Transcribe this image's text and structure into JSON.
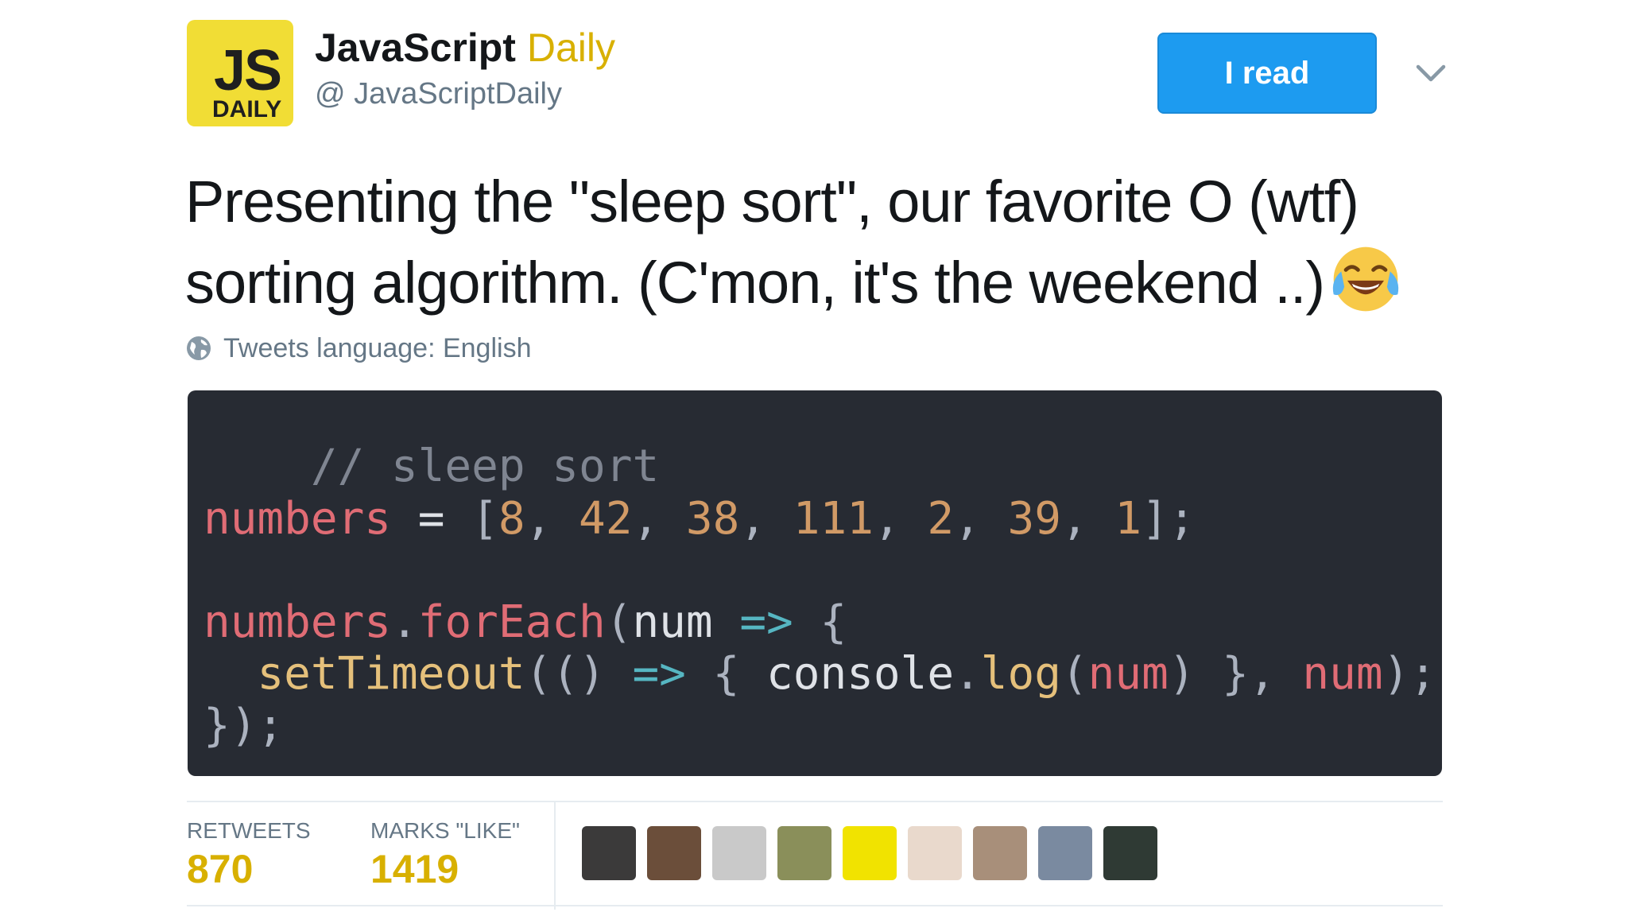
{
  "account": {
    "avatar_js": "JS",
    "avatar_daily": "DAILY",
    "name_part1": "JavaScript",
    "name_part2": "Daily",
    "handle": "@ JavaScriptDaily"
  },
  "follow_button": {
    "label": "I read"
  },
  "tweet": {
    "text": "Presenting the \"sleep sort\", our favorite O (wtf) sorting algorithm. (C'mon, it's the weekend ..)",
    "emoji_icon": "face-with-tears-of-joy-icon",
    "language_label": "Tweets language: English"
  },
  "code": {
    "comment": "// sleep sort",
    "numbers_var": "numbers",
    "numbers_values": [
      "8",
      "42",
      "38",
      "111",
      "2",
      "39",
      "1"
    ],
    "line3_object": "numbers",
    "line3_method": "forEach",
    "line3_param": "num",
    "line4_fn": "setTimeout",
    "line4_console": "console",
    "line4_log": "log",
    "line4_arg": "num",
    "line4_delay": "num"
  },
  "stats": {
    "retweets_label": "RETWEETS",
    "retweets_value": "870",
    "likes_label": "MARKS \"LIKE\"",
    "likes_value": "1419"
  },
  "liker_avatars": [
    {
      "name": "liker-avatar-1",
      "color": "#3b3a3a"
    },
    {
      "name": "liker-avatar-2",
      "color": "#6b4e3a"
    },
    {
      "name": "liker-avatar-3",
      "color": "#c9c9c9"
    },
    {
      "name": "liker-avatar-4",
      "color": "#8a8f5a"
    },
    {
      "name": "liker-avatar-5",
      "color": "#f1e300"
    },
    {
      "name": "liker-avatar-6",
      "color": "#e9d9cc"
    },
    {
      "name": "liker-avatar-7",
      "color": "#a88f7a"
    },
    {
      "name": "liker-avatar-8",
      "color": "#7a8aa0"
    },
    {
      "name": "liker-avatar-9",
      "color": "#2f3a34"
    }
  ],
  "colors": {
    "brand_yellow": "#f1dd35",
    "button_blue": "#1d9bf0",
    "code_bg": "#272b33"
  }
}
